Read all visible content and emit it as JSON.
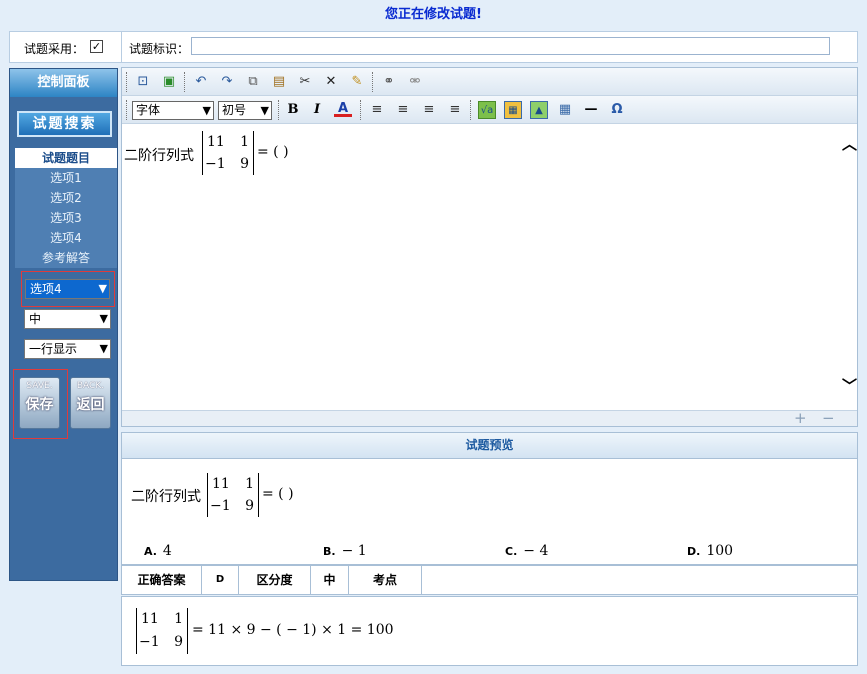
{
  "header": {
    "title": "您正在修改试题!"
  },
  "top_bar": {
    "adopt_label": "试题采用：",
    "adopt_checked": "✓",
    "id_label": "试题标识：",
    "id_value": ""
  },
  "sidebar": {
    "panel_title": "控制面板",
    "search_button": "试题搜索",
    "items": [
      {
        "label": "试题题目"
      },
      {
        "label": "选项1"
      },
      {
        "label": "选项2"
      },
      {
        "label": "选项3"
      },
      {
        "label": "选项4"
      },
      {
        "label": "参考解答"
      }
    ],
    "select_option": "选项4",
    "select_difficulty": "中",
    "select_display": "一行显示",
    "save_small": "SAVE.",
    "save_label": "保存",
    "back_small": "BACK.",
    "back_label": "返回"
  },
  "toolbar": {
    "font_select": "字体",
    "size_select": "初号",
    "bold": "B",
    "italic": "I",
    "font_color": "A",
    "omega": "Ω"
  },
  "question": {
    "prefix": "二阶行列式",
    "matrix": [
      "11",
      "1",
      "−1",
      "9"
    ],
    "suffix": "= ( )"
  },
  "preview": {
    "title": "试题预览",
    "options": [
      {
        "key": "A.",
        "value": "4"
      },
      {
        "key": "B.",
        "value": "− 1"
      },
      {
        "key": "C.",
        "value": "− 4"
      },
      {
        "key": "D.",
        "value": "100"
      }
    ]
  },
  "answer_row": {
    "correct_label": "正确答案",
    "correct_value": "D",
    "discrimination_label": "区分度",
    "discrimination_value": "中",
    "point_label": "考点"
  },
  "solution": {
    "expression": "= 11 × 9 − ( − 1) × 1 = 100"
  }
}
